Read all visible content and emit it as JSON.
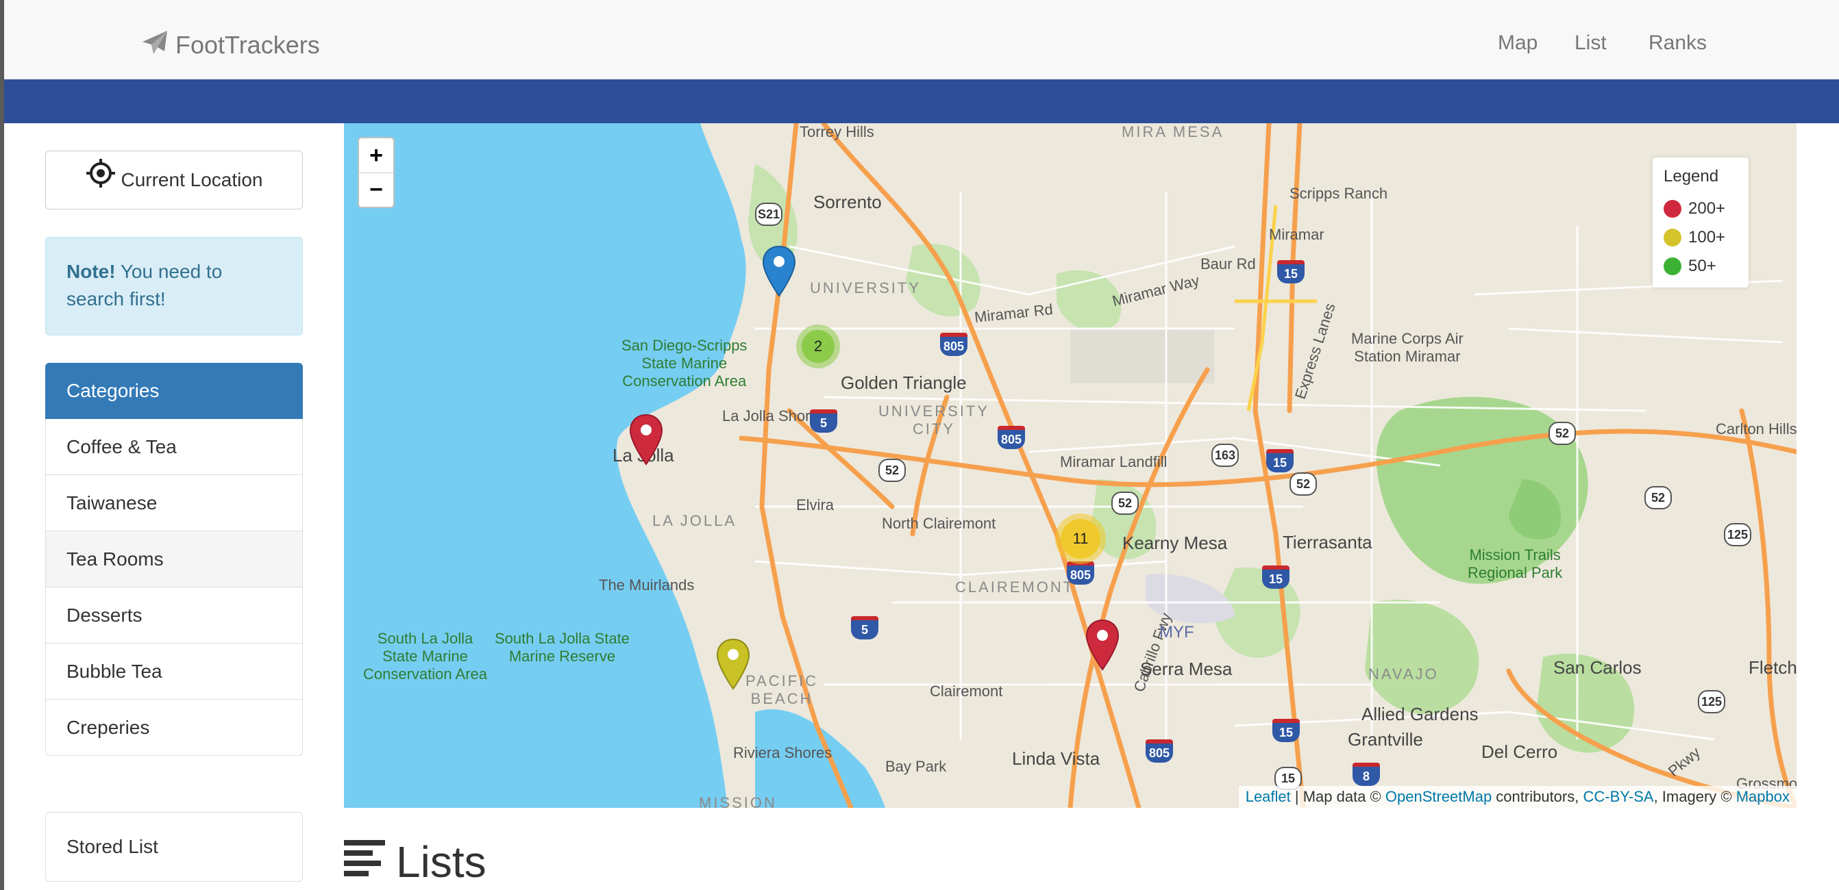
{
  "app": {
    "brand": "FootTrackers",
    "brand_icon": "paper-plane-icon"
  },
  "nav": {
    "links": [
      "Map",
      "List",
      "Ranks"
    ]
  },
  "sidebar": {
    "current_location_label": "Current Location",
    "current_location_icon": "crosshairs-icon",
    "note_strong": "Note!",
    "note_text": "You need to search first!",
    "categories_heading": "Categories",
    "categories": [
      "Coffee & Tea",
      "Taiwanese",
      "Tea Rooms",
      "Desserts",
      "Bubble Tea",
      "Creperies"
    ],
    "active_category": "Tea Rooms",
    "stored_list_label": "Stored List"
  },
  "map": {
    "zoom_in": "+",
    "zoom_out": "−",
    "legend": {
      "title": "Legend",
      "items": [
        {
          "label": "200+",
          "color": "#d0283e"
        },
        {
          "label": "100+",
          "color": "#d4c32a"
        },
        {
          "label": "50+",
          "color": "#3cb133"
        }
      ]
    },
    "clusters": [
      {
        "count": "2",
        "color": "#8ccb4a"
      },
      {
        "count": "11",
        "color": "#f0c92c"
      }
    ],
    "markers": [
      {
        "name": "blue-marker",
        "color": "#2a83cf"
      },
      {
        "name": "red-marker-la-jolla",
        "color": "#cd2a3e"
      },
      {
        "name": "red-marker-kearny-mesa",
        "color": "#cd2a3e"
      },
      {
        "name": "yellow-marker-pacific-beach",
        "color": "#c8c226"
      }
    ],
    "places": {
      "torrey_hills": "Torrey Hills",
      "mira_mesa": "MIRA MESA",
      "scripps_ranch": "Scripps Ranch",
      "sorrento": "Sorrento",
      "miramar": "Miramar",
      "baur_rd": "Baur Rd",
      "university": "UNIVERSITY",
      "miramar_rd": "Miramar Rd",
      "miramar_way": "Miramar Way",
      "express_lanes": "Express Lanes",
      "mcas": "Marine Corps Air\nStation Miramar",
      "sdsm": "San Diego-Scripps\nState Marine\nConservation Area",
      "golden_triangle": "Golden Triangle",
      "university_city": "UNIVERSITY\nCITY",
      "la_jolla_shores": "La Jolla Shores",
      "la_jolla": "La Jolla",
      "miramar_landfill": "Miramar Landfill",
      "carlton_hills": "Carlton Hills",
      "la_jolla_caps": "LA JOLLA",
      "elvira": "Elvira",
      "north_clairemont": "North Clairemont",
      "kearny_mesa": "Kearny Mesa",
      "tierrasanta": "Tierrasanta",
      "mission_trails": "Mission Trails\nRegional Park",
      "the_muirlands": "The Muirlands",
      "clairemont_caps": "CLAIREMONT",
      "cabrillo_fwy": "Cabrillo Fwy",
      "myf": "MYF",
      "south_lj_smca": "South La Jolla\nState Marine\nConservation Area",
      "south_lj_smr": "South La Jolla State\nMarine Reserve",
      "pacific_beach": "PACIFIC\nBEACH",
      "serra_mesa": "Serra Mesa",
      "navajo": "NAVAJO",
      "san_carlos": "San Carlos",
      "fletcher_hills": "Fletcher Hil",
      "clairemont": "Clairemont",
      "allied_gardens": "Allied Gardens",
      "grantville": "Grantville",
      "del_cerro": "Del Cerro",
      "riviera_shores": "Riviera Shores",
      "bay_park": "Bay Park",
      "linda_vista": "Linda Vista",
      "mission": "MISSION",
      "grossmont": "Grossmo",
      "pkwy": "Pkwy"
    },
    "shields": {
      "s521": "S21",
      "i805a": "805",
      "i5a": "5",
      "i805b": "805",
      "r52a": "52",
      "r163": "163",
      "i15a": "15",
      "i15b": "15",
      "r52b": "52",
      "r52c": "52",
      "r52d": "52",
      "r52e": "52",
      "r125a": "125",
      "i805c": "805",
      "i15c": "15",
      "i5b": "5",
      "r125b": "125",
      "i15d": "15",
      "i805d": "805",
      "i8": "8",
      "r15": "15"
    },
    "attribution": {
      "leaflet": "Leaflet",
      "sep": " | Map data © ",
      "osm": "OpenStreetMap",
      "contrib": " contributors, ",
      "license": "CC-BY-SA",
      "imagery": ", Imagery © ",
      "mapbox": "Mapbox"
    }
  },
  "lists": {
    "heading": "Lists",
    "icon": "align-left-icon"
  }
}
